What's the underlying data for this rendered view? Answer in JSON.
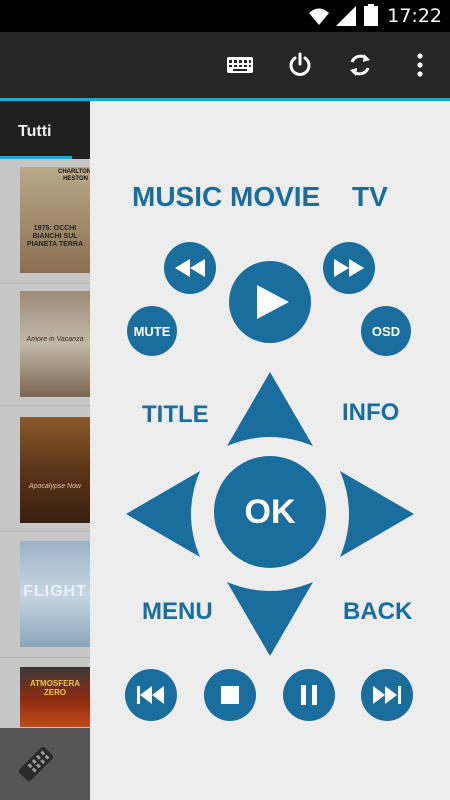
{
  "status_bar": {
    "time": "17:22"
  },
  "action_bar": {
    "icons": [
      "keyboard-icon",
      "power-icon",
      "refresh-icon",
      "overflow-menu-icon"
    ]
  },
  "media_list": {
    "tab_label": "Tutti",
    "posters": [
      {
        "title": "1975: OCCHI BIANCHI SUL PIANETA TERRA",
        "actor": "CHARLTON HESTON"
      },
      {
        "title": "Amore in Vacanza"
      },
      {
        "title": "Apocalypse Now"
      },
      {
        "title": "FLIGHT"
      },
      {
        "title": "ATMOSFERA ZERO"
      }
    ]
  },
  "remote": {
    "modes": {
      "music": "MUSIC",
      "movie": "MOVIE",
      "tv": "TV"
    },
    "mute": "MUTE",
    "osd": "OSD",
    "title": "TITLE",
    "info": "INFO",
    "ok": "OK",
    "menu": "MENU",
    "back": "BACK",
    "accent_color": "#1a6e9e"
  }
}
